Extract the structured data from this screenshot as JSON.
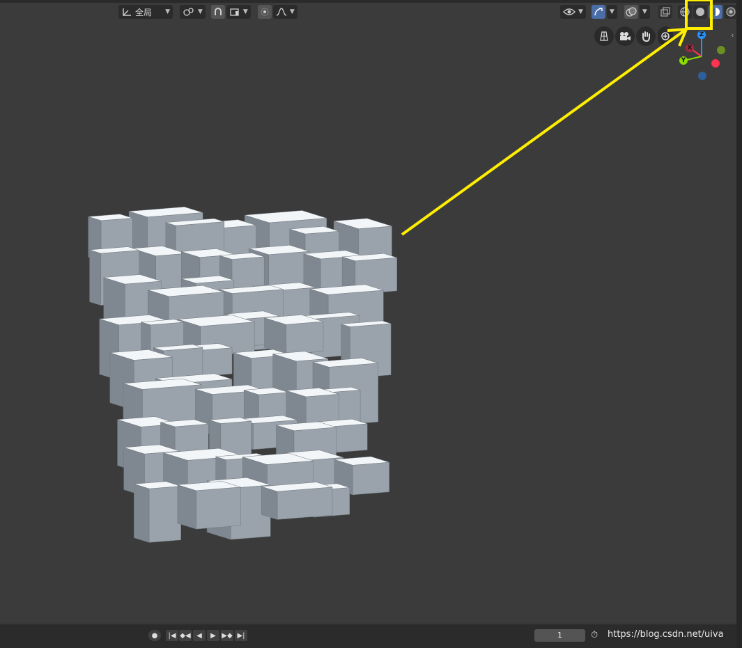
{
  "header": {
    "transform_orientation": "全局",
    "shading_modes": [
      "wireframe",
      "solid",
      "material-preview",
      "rendered"
    ],
    "active_shading": "material-preview"
  },
  "navigation": {
    "gizmo_axes": [
      "X",
      "Y",
      "Z"
    ]
  },
  "timeline": {
    "current_frame": "1"
  },
  "watermark": "https://blog.csdn.net/uiva",
  "colors": {
    "highlight": "#ffee00",
    "active_button": "#4b6ea8",
    "x_axis": "#ff3352",
    "y_axis": "#8bdc00",
    "z_axis": "#2890ff"
  }
}
